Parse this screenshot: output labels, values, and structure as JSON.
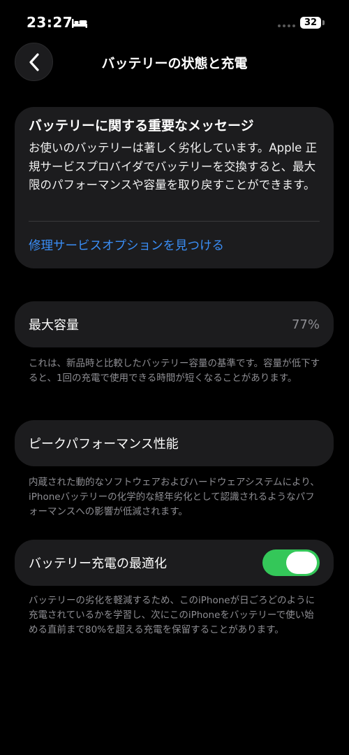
{
  "status_bar": {
    "time": "23:27",
    "battery_level": "32"
  },
  "nav": {
    "title": "バッテリーの状態と充電"
  },
  "important_message": {
    "title": "バッテリーに関する重要なメッセージ",
    "body": "お使いのバッテリーは著しく劣化しています。Apple 正規サービスプロバイダでバッテリーを交換すると、最大限のパフォーマンスや容量を取り戻すことができます。",
    "link": "修理サービスオプションを見つける"
  },
  "max_capacity": {
    "label": "最大容量",
    "value": "77%",
    "footnote": "これは、新品時と比較したバッテリー容量の基準です。容量が低下すると、1回の充電で使用できる時間が短くなることがあります。"
  },
  "peak_performance": {
    "label": "ピークパフォーマンス性能",
    "footnote": "内蔵された動的なソフトウェアおよびハードウェアシステムにより、iPhoneバッテリーの化学的な経年劣化として認識されるようなパフォーマンスへの影響が低減されます。"
  },
  "optimized_charging": {
    "label": "バッテリー充電の最適化",
    "enabled": true,
    "footnote": "バッテリーの劣化を軽減するため、このiPhoneが日ごろどのように充電されているかを学習し、次にこのiPhoneをバッテリーで使い始める直前まで80%を超える充電を保留することがあります。"
  },
  "colors": {
    "background": "#000000",
    "card": "#1c1c1e",
    "link": "#3a8ef6",
    "toggle_on": "#34c759",
    "secondary_text": "#8e8e93"
  },
  "icons": {
    "back": "chevron-left-icon",
    "sleep": "bed-icon"
  }
}
